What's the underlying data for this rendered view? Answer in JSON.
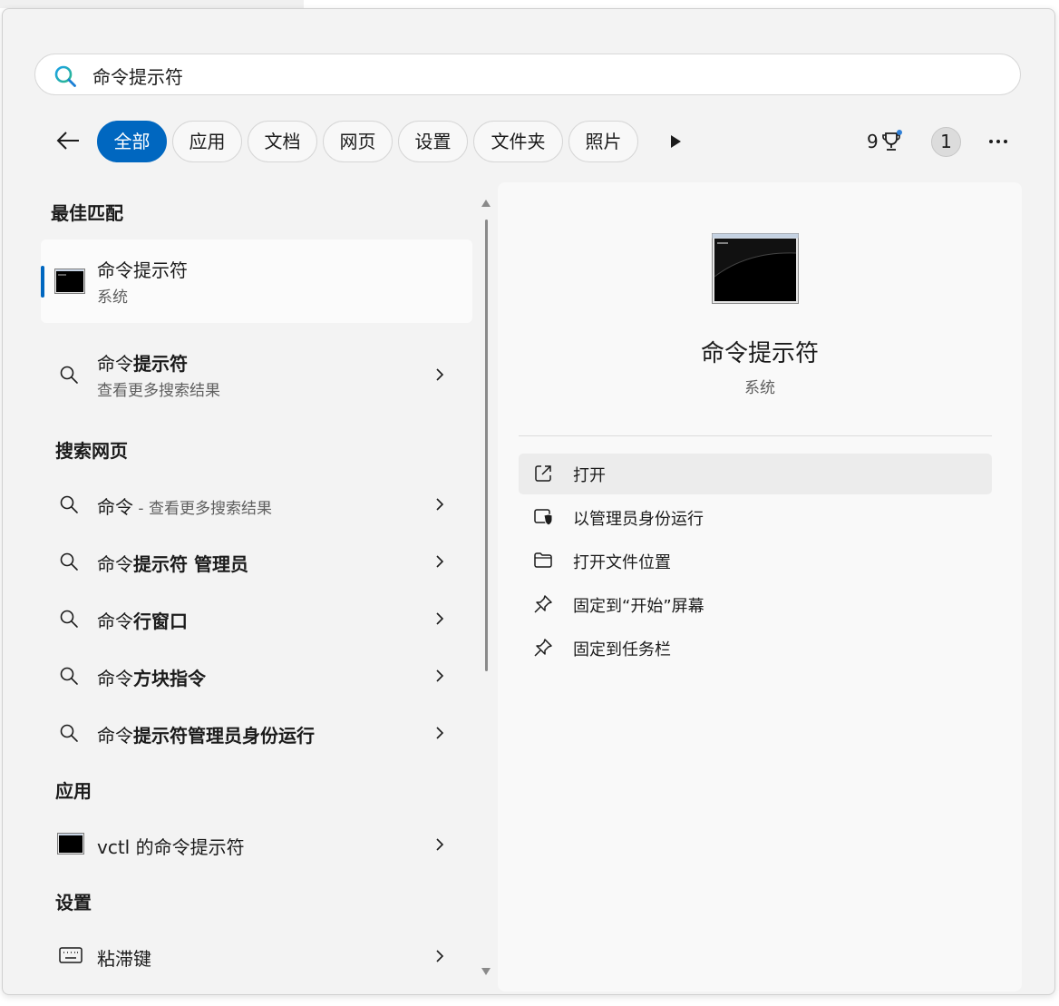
{
  "search": {
    "query": "命令提示符"
  },
  "filters": [
    {
      "label": "全部",
      "active": true
    },
    {
      "label": "应用"
    },
    {
      "label": "文档"
    },
    {
      "label": "网页"
    },
    {
      "label": "设置"
    },
    {
      "label": "文件夹"
    },
    {
      "label": "照片"
    }
  ],
  "header": {
    "rewards_points": "9",
    "badge_count": "1"
  },
  "best_match": {
    "heading": "最佳匹配",
    "title": "命令提示符",
    "subtitle": "系统"
  },
  "more_results": {
    "prefix": "命令",
    "bold": "提示符",
    "subtitle": "查看更多搜索结果"
  },
  "web": {
    "heading": "搜索网页",
    "items": [
      {
        "prefix": "命令",
        "bold": "",
        "suffix": " - 查看更多搜索结果"
      },
      {
        "prefix": "命令",
        "bold": "提示符 管理员",
        "suffix": ""
      },
      {
        "prefix": "命令",
        "bold": "行窗口",
        "suffix": ""
      },
      {
        "prefix": "命令",
        "bold": "方块指令",
        "suffix": ""
      },
      {
        "prefix": "命令",
        "bold": "提示符管理员身份运行",
        "suffix": ""
      }
    ]
  },
  "apps": {
    "heading": "应用",
    "items": [
      {
        "label": "vctl 的命令提示符"
      }
    ]
  },
  "settings": {
    "heading": "设置",
    "items": [
      {
        "label": "粘滞键"
      }
    ]
  },
  "detail": {
    "title": "命令提示符",
    "subtitle": "系统",
    "actions": [
      {
        "label": "打开",
        "icon": "open-external-icon"
      },
      {
        "label": "以管理员身份运行",
        "icon": "shield-admin-icon"
      },
      {
        "label": "打开文件位置",
        "icon": "folder-icon"
      },
      {
        "label": "固定到“开始”屏幕",
        "icon": "pin-icon"
      },
      {
        "label": "固定到任务栏",
        "icon": "pin-icon"
      }
    ]
  },
  "colors": {
    "accent": "#0067c0",
    "background": "#f3f3f3",
    "panel": "#f9f9f9"
  }
}
